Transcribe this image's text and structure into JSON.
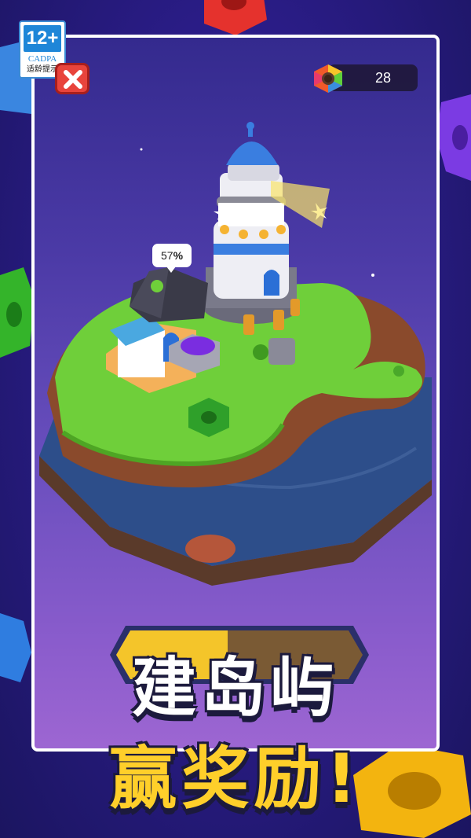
{
  "age_rating": {
    "age": "12+",
    "org": "CADPA",
    "tip": "适龄提示"
  },
  "hud": {
    "nut_count": "28"
  },
  "progress": {
    "label": "57",
    "unit": "%",
    "value": 0.57
  },
  "promo": {
    "line1": "建岛屿",
    "line2": "赢奖励!"
  },
  "colors": {
    "frame_border": "#ffffff",
    "close": "#e8443c",
    "title_yellow": "#ffcf2a",
    "grass": "#6fcf3a"
  },
  "icons": {
    "close": "close-icon",
    "currency": "rainbow-nut-icon"
  }
}
